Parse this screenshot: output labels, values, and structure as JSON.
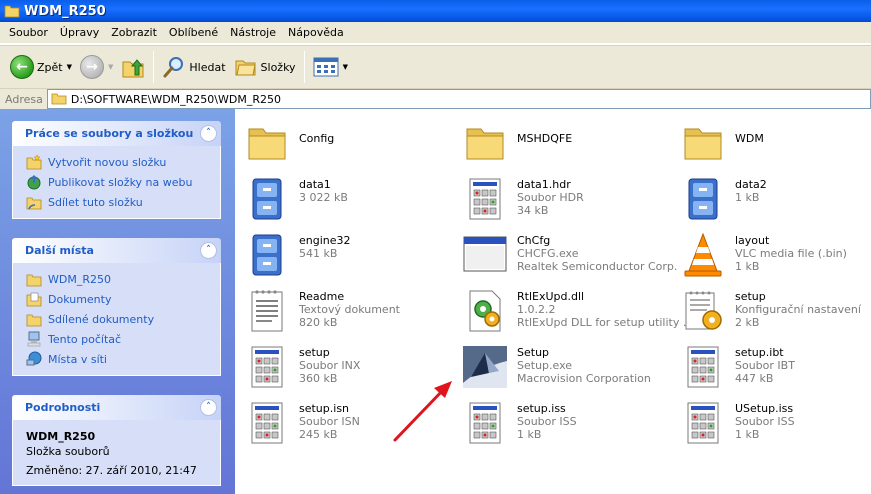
{
  "window": {
    "title": "WDM_R250"
  },
  "menu": [
    "Soubor",
    "Úpravy",
    "Zobrazit",
    "Oblíbené",
    "Nástroje",
    "Nápověda"
  ],
  "toolbar": {
    "back_label": "Zpět",
    "search_label": "Hledat",
    "folders_label": "Složky"
  },
  "address": {
    "label": "Adresa",
    "path": "D:\\SOFTWARE\\WDM_R250\\WDM_R250"
  },
  "tasks": {
    "file_tasks": {
      "title": "Práce se soubory a složkou",
      "items": [
        "Vytvořit novou složku",
        "Publikovat složky na webu",
        "Sdílet tuto složku"
      ]
    },
    "other_places": {
      "title": "Další místa",
      "items": [
        "WDM_R250",
        "Dokumenty",
        "Sdílené dokumenty",
        "Tento počítač",
        "Místa v síti"
      ]
    },
    "details": {
      "title": "Podrobnosti",
      "name": "WDM_R250",
      "type": "Složka souborů",
      "modified": "Změněno: 27. září 2010, 21:47"
    }
  },
  "files": [
    {
      "name": "Config",
      "icon": "folder-icon",
      "lines": []
    },
    {
      "name": "MSHDQFE",
      "icon": "folder-icon",
      "lines": []
    },
    {
      "name": "WDM",
      "icon": "folder-icon",
      "lines": []
    },
    {
      "name": "data1",
      "icon": "cabinet-icon",
      "lines": [
        "3 022 kB"
      ]
    },
    {
      "name": "data1.hdr",
      "icon": "generic-file-icon",
      "lines": [
        "Soubor HDR",
        "34 kB"
      ]
    },
    {
      "name": "data2",
      "icon": "cabinet-icon",
      "lines": [
        "1 kB"
      ]
    },
    {
      "name": "engine32",
      "icon": "cabinet-icon",
      "lines": [
        "541 kB"
      ]
    },
    {
      "name": "ChCfg",
      "icon": "application-window-icon",
      "lines": [
        "CHCFG.exe",
        "Realtek Semiconductor Corp."
      ]
    },
    {
      "name": "layout",
      "icon": "vlc-cone-icon",
      "lines": [
        "VLC media file (.bin)",
        "1 kB"
      ]
    },
    {
      "name": "Readme",
      "icon": "text-document-icon",
      "lines": [
        "Textový dokument",
        "820 kB"
      ]
    },
    {
      "name": "RtlExUpd.dll",
      "icon": "dll-gear-icon",
      "lines": [
        "1.0.2.2",
        "RtlExUpd DLL for setup utility ..."
      ]
    },
    {
      "name": "setup",
      "icon": "config-settings-icon",
      "lines": [
        "Konfigurační nastavení",
        "2 kB"
      ]
    },
    {
      "name": "setup",
      "icon": "generic-file-icon",
      "lines": [
        "Soubor INX",
        "360 kB"
      ]
    },
    {
      "name": "Setup",
      "icon": "setup-installer-icon",
      "lines": [
        "Setup.exe",
        "Macrovision Corporation"
      ]
    },
    {
      "name": "setup.ibt",
      "icon": "generic-file-icon",
      "lines": [
        "Soubor IBT",
        "447 kB"
      ]
    },
    {
      "name": "setup.isn",
      "icon": "generic-file-icon",
      "lines": [
        "Soubor ISN",
        "245 kB"
      ]
    },
    {
      "name": "setup.iss",
      "icon": "generic-file-icon",
      "lines": [
        "Soubor ISS",
        "1 kB"
      ]
    },
    {
      "name": "USetup.iss",
      "icon": "generic-file-icon",
      "lines": [
        "Soubor ISS",
        "1 kB"
      ]
    }
  ],
  "colors": {
    "titlebar": "#0556e3",
    "link": "#215dc6",
    "arrow": "#e0141c"
  }
}
